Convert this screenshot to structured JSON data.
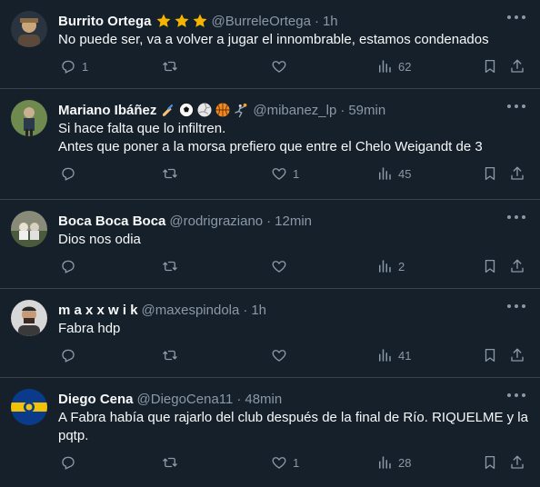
{
  "tweets": [
    {
      "name": "Burrito Ortega",
      "badges": [
        "star",
        "star",
        "star"
      ],
      "handle": "@BurreleOrtega",
      "time": "1h",
      "lines": [
        "No puede ser, va a volver a jugar el innombrable, estamos condenados"
      ],
      "replies": "1",
      "retweets": "",
      "likes": "",
      "views": "62",
      "avatar_colors": [
        "#5b4a3c",
        "#c9a77a"
      ]
    },
    {
      "name": "Mariano Ibáñez",
      "badges": [
        "writing-hand",
        "soccer",
        "volleyball",
        "basketball",
        "handball"
      ],
      "handle": "@mibanez_lp",
      "time": "59min",
      "lines": [
        "Si hace falta que lo infiltren.",
        "Antes que poner a la morsa prefiero que entre el Chelo Weigandt de 3"
      ],
      "replies": "",
      "retweets": "",
      "likes": "1",
      "views": "45",
      "avatar_colors": [
        "#4b6b3a",
        "#9bb07a"
      ]
    },
    {
      "name": "Boca Boca Boca",
      "badges": [],
      "handle": "@rodrigraziano",
      "time": "12min",
      "lines": [
        "Dios nos odia"
      ],
      "replies": "",
      "retweets": "",
      "likes": "",
      "views": "2",
      "avatar_colors": [
        "#6a6a5a",
        "#d0d0c0"
      ]
    },
    {
      "name": "m a x x w i k",
      "badges": [],
      "handle": "@maxespindola",
      "time": "1h",
      "lines": [
        "Fabra hdp"
      ],
      "replies": "",
      "retweets": "",
      "likes": "",
      "views": "41",
      "avatar_colors": [
        "#3a3a3a",
        "#c59a7a"
      ]
    },
    {
      "name": "Diego Cena",
      "badges": [],
      "handle": "@DiegoCena11",
      "time": "48min",
      "lines": [
        "A Fabra había que rajarlo del club después de la final de Río. RIQUELME y la pqtp."
      ],
      "replies": "",
      "retweets": "",
      "likes": "1",
      "views": "28",
      "avatar_colors": [
        "#0a3a8a",
        "#f2c20a"
      ]
    }
  ],
  "colors": {
    "background": "#15202b",
    "divider": "#38444d",
    "muted_text": "#8b98a5",
    "primary_text": "#f7f9f9"
  },
  "icons": {
    "reply": "reply-icon",
    "retweet": "retweet-icon",
    "like": "heart-icon",
    "views": "analytics-icon",
    "bookmark": "bookmark-icon",
    "share": "share-icon",
    "more": "more-icon"
  }
}
